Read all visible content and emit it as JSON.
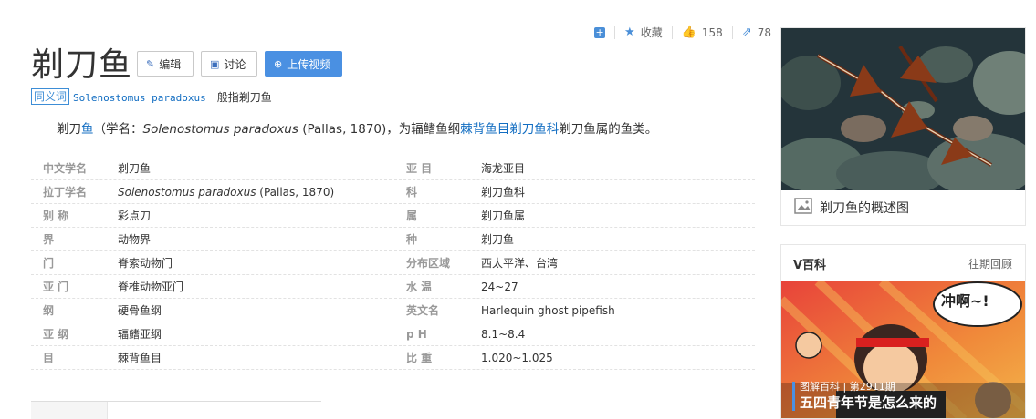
{
  "social": {
    "add_icon": "plus-square-icon",
    "favorite_label": "收藏",
    "like_count": "158",
    "share_count": "78"
  },
  "header": {
    "title": "剃刀鱼",
    "edit_label": "编辑",
    "discuss_label": "讨论",
    "upload_label": "上传视频"
  },
  "synonym": {
    "tag": "同义词",
    "latin": "Solenostomus paradoxus",
    "rest": "一般指剃刀鱼"
  },
  "summary": {
    "part1": "剃刀",
    "link1": "鱼",
    "part2": "（学名：",
    "latin": "Solenostomus paradoxus",
    "part3": " (Pallas, 1870)，为辐鳍鱼纲",
    "link2": "棘背鱼目",
    "link3": "剃刀鱼科",
    "part4": "剃刀鱼属的鱼类。"
  },
  "info_left": [
    {
      "key": "中文学名",
      "value": "剃刀鱼"
    },
    {
      "key": "拉丁学名",
      "value_italic": "Solenostomus paradoxus",
      "value": " (Pallas, 1870)"
    },
    {
      "key": "别    称",
      "value": "彩点刀"
    },
    {
      "key": "界",
      "value": "动物界"
    },
    {
      "key": "门",
      "value": "脊索动物门"
    },
    {
      "key": "亚    门",
      "value": "脊椎动物亚门"
    },
    {
      "key": "纲",
      "value": "硬骨鱼纲"
    },
    {
      "key": "亚    纲",
      "value": "辐鳍亚纲"
    },
    {
      "key": "目",
      "value": "棘背鱼目"
    }
  ],
  "info_right": [
    {
      "key": "亚    目",
      "value": "海龙亚目"
    },
    {
      "key": "科",
      "value": "剃刀鱼科"
    },
    {
      "key": "属",
      "value": "剃刀鱼属"
    },
    {
      "key": "种",
      "value": "剃刀鱼"
    },
    {
      "key": "分布区域",
      "value": "西太平洋、台湾"
    },
    {
      "key": "水    温",
      "value": "24~27"
    },
    {
      "key": "英文名",
      "value": "Harlequin ghost pipefish"
    },
    {
      "key": "p    H",
      "value": "8.1~8.4"
    },
    {
      "key": "比    重",
      "value": "1.020~1.025"
    }
  ],
  "album": {
    "caption": "剃刀鱼的概述图"
  },
  "vbaike": {
    "title": "V百科",
    "more": "往期回顾",
    "bubble": "冲啊~!",
    "sub": "图解百科 | 第2911期",
    "headline": "五四青年节是怎么来的"
  },
  "colors": {
    "link": "#136ec2",
    "accent": "#4a90e2"
  }
}
